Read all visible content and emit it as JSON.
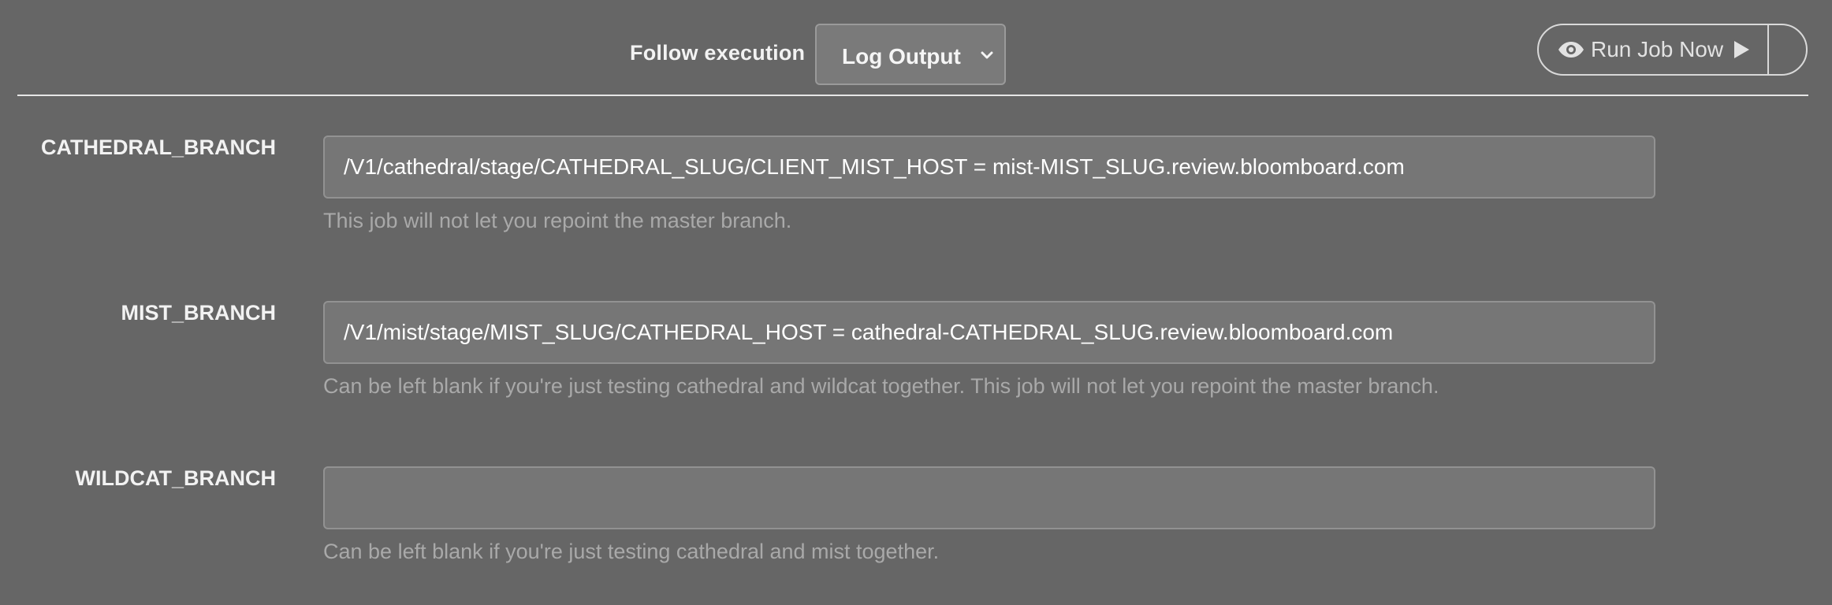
{
  "header": {
    "follow_label": "Follow execution",
    "follow_select": {
      "selected": "Log Output",
      "icon": "chevron-down-icon"
    },
    "run_button": {
      "label": "Run Job Now",
      "leading_icon": "eye-icon",
      "trailing_icon": "play-icon"
    }
  },
  "fields": [
    {
      "label": "CATHEDRAL_BRANCH",
      "value": "/V1/cathedral/stage/CATHEDRAL_SLUG/CLIENT_MIST_HOST = mist-MIST_SLUG.review.bloomboard.com",
      "help": "This job will not let you repoint the master branch."
    },
    {
      "label": "MIST_BRANCH",
      "value": "/V1/mist/stage/MIST_SLUG/CATHEDRAL_HOST = cathedral-CATHEDRAL_SLUG.review.bloomboard.com",
      "help": "Can be left blank if you're just testing cathedral and wildcat together. This job will not let you repoint the master branch."
    },
    {
      "label": "WILDCAT_BRANCH",
      "value": "",
      "help": "Can be left blank if you're just testing cathedral and mist together."
    }
  ],
  "colors": {
    "background": "#666666",
    "input_background": "#767676",
    "help_text": "#a9a9a9",
    "label_text": "#f2f2f2"
  }
}
